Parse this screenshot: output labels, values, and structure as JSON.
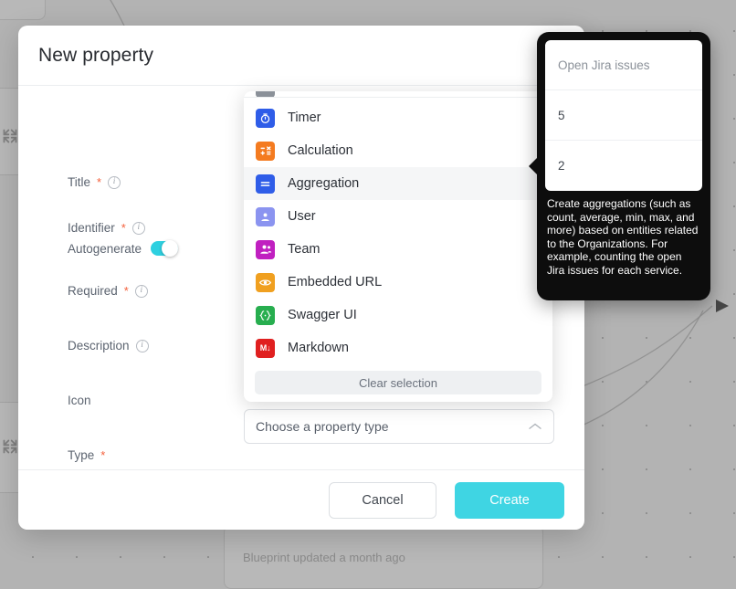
{
  "background": {
    "node_top_label": "",
    "node_left_1_label": "",
    "node_left_2_label": "",
    "node_bottom_label": "Blueprint updated a month ago",
    "expand_icon": "expand-arrows-icon"
  },
  "dialog": {
    "title": "New property",
    "fields": [
      {
        "label": "Title",
        "required": true,
        "info": true
      },
      {
        "label": "Identifier",
        "required": true,
        "info": true
      },
      {
        "label": "Required",
        "required": true,
        "info": true
      },
      {
        "label": "Description",
        "required": false,
        "info": true
      },
      {
        "label": "Icon",
        "required": false,
        "info": false
      },
      {
        "label": "Type",
        "required": true,
        "info": false
      }
    ],
    "autogenerate": {
      "label": "Autogenerate",
      "enabled": true,
      "accent_color": "#2ed0e0"
    },
    "type_select": {
      "placeholder": "Choose a property type",
      "value": "",
      "chevron": "chevron-up-icon"
    },
    "footer": {
      "cancel_label": "Cancel",
      "create_label": "Create",
      "create_color": "#3fd5e3"
    }
  },
  "dropdown": {
    "clear_label": "Clear selection",
    "selected": "Aggregation",
    "items": [
      {
        "label": "Timer",
        "icon": "timer-icon",
        "color": "#2f5de8"
      },
      {
        "label": "Calculation",
        "icon": "calculator-icon",
        "color": "#f47b20"
      },
      {
        "label": "Aggregation",
        "icon": "aggregation-icon",
        "color": "#2f5de8"
      },
      {
        "label": "User",
        "icon": "user-icon",
        "color": "#8b94f0"
      },
      {
        "label": "Team",
        "icon": "team-icon",
        "color": "#c020c0"
      },
      {
        "label": "Embedded URL",
        "icon": "eye-icon",
        "color": "#f0a020"
      },
      {
        "label": "Swagger UI",
        "icon": "swagger-icon",
        "color": "#27ae4f"
      },
      {
        "label": "Markdown",
        "icon": "markdown-icon",
        "color": "#e02020"
      }
    ]
  },
  "popover": {
    "preview": {
      "header": "Open Jira issues",
      "rows": [
        "5",
        "2"
      ]
    },
    "description": "Create aggregations (such as count, average, min, max, and more) based on entities related to the Organizations. For example, counting the open Jira issues for each service."
  }
}
